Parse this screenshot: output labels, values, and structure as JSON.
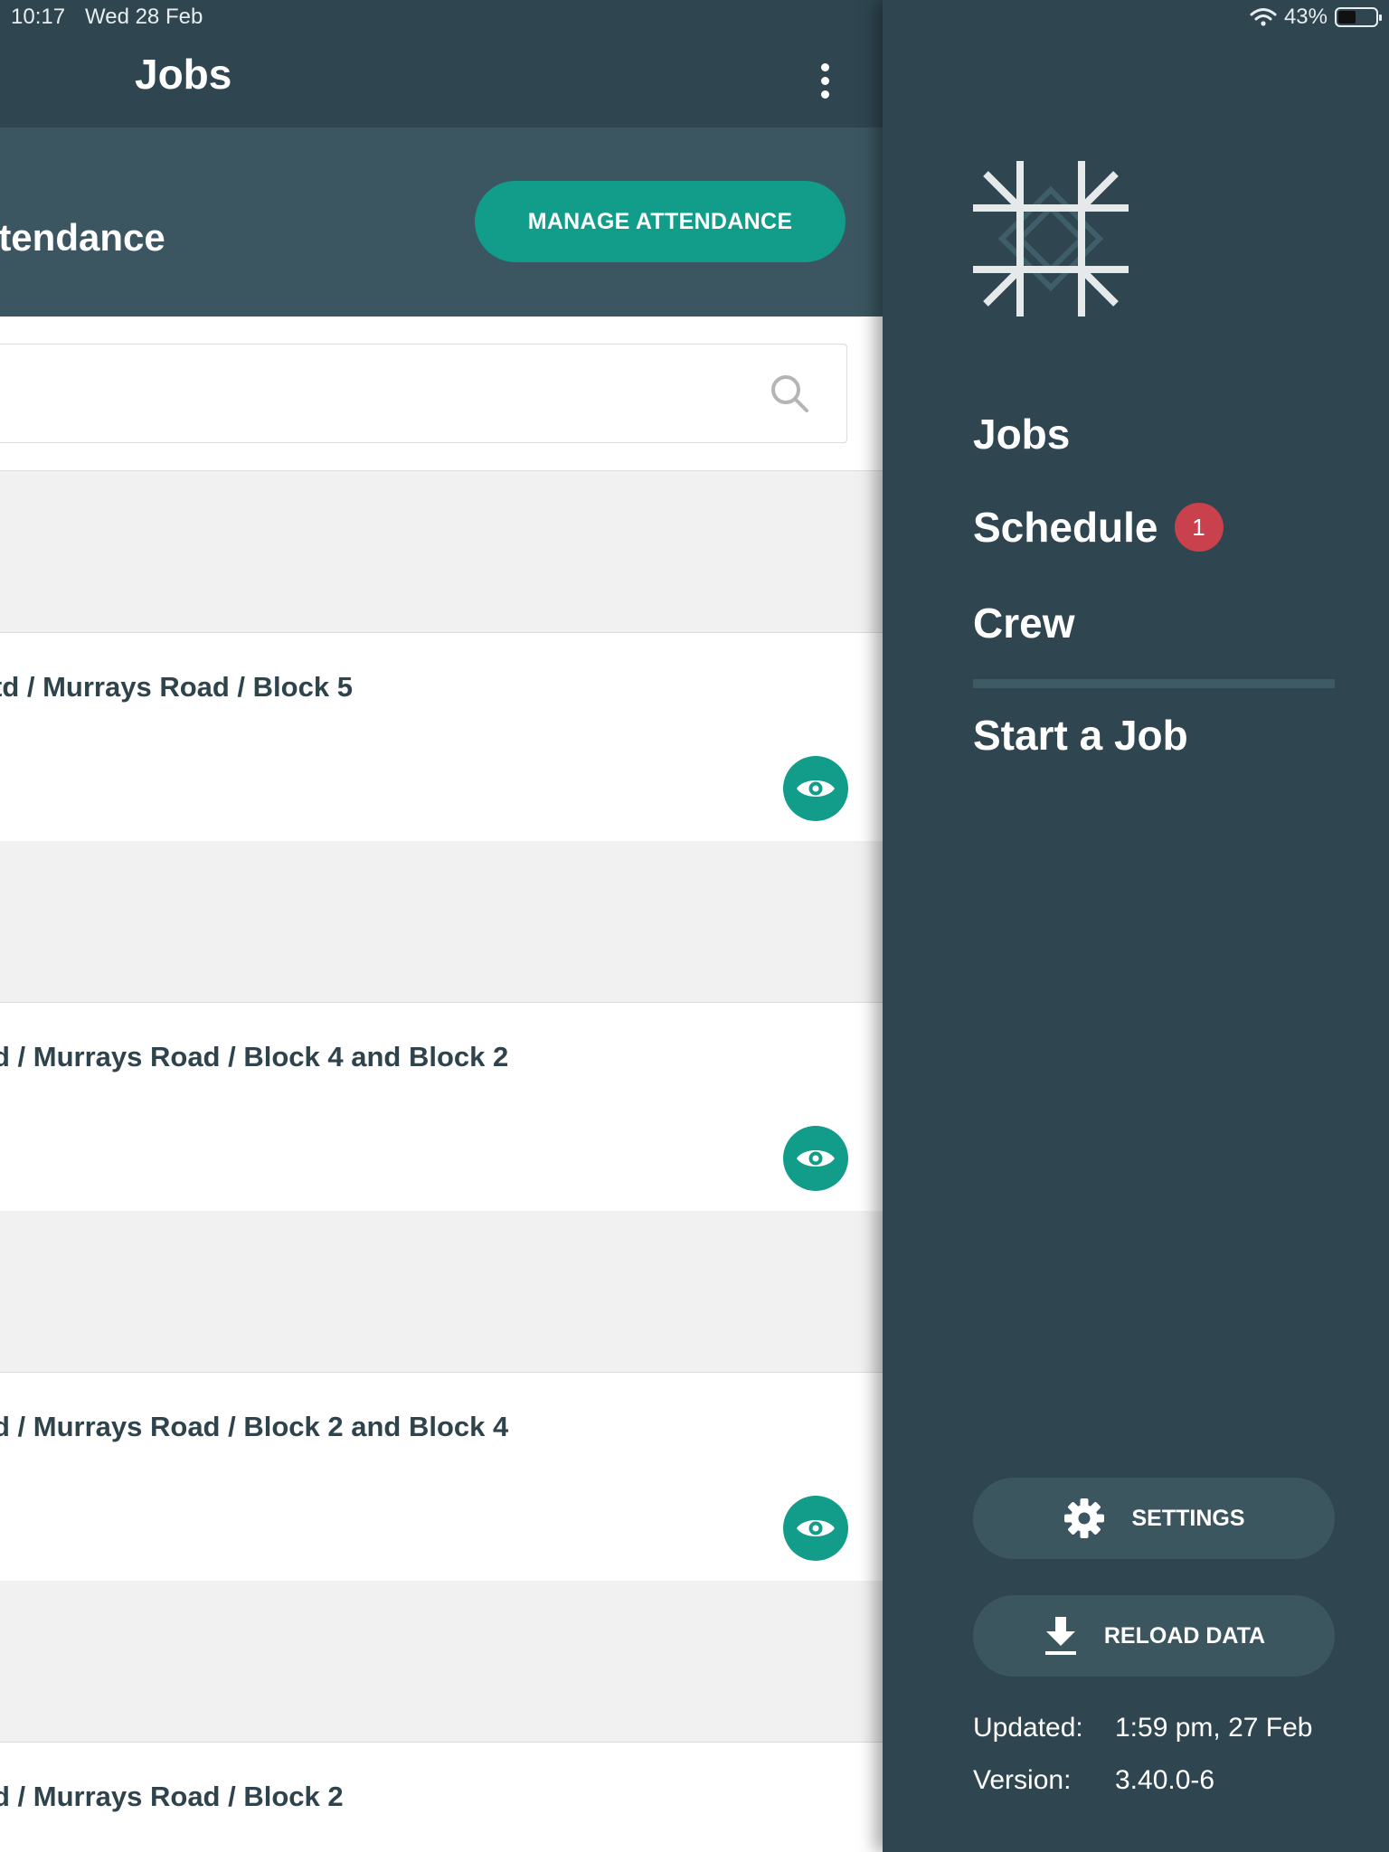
{
  "status_bar": {
    "time": "10:17",
    "date": "Wed 28 Feb",
    "battery": "43%"
  },
  "appbar": {
    "title": "Jobs"
  },
  "attendance": {
    "title": "Attendance",
    "manage_label": "MANAGE ATTENDANCE"
  },
  "search": {
    "placeholder": ""
  },
  "jobs": [
    {
      "title": "td / Murrays Road / Block 5"
    },
    {
      "title": "d / Murrays Road / Block 4 and Block 2"
    },
    {
      "title": "d / Murrays Road / Block 2 and Block 4"
    },
    {
      "title": "d / Murrays Road / Block 2"
    }
  ],
  "drawer": {
    "nav": {
      "jobs": "Jobs",
      "schedule": "Schedule",
      "schedule_badge": "1",
      "crew": "Crew",
      "start_job": "Start a Job"
    },
    "settings_label": "SETTINGS",
    "reload_label": "RELOAD DATA",
    "updated_label": "Updated:",
    "updated_value": "1:59 pm, 27 Feb",
    "version_label": "Version:",
    "version_value": "3.40.0-6"
  },
  "colors": {
    "primary_dark": "#2f4650",
    "accent_teal": "#129c8a",
    "badge_red": "#c8414d",
    "surface": "#ffffff",
    "background": "#f1f1f1"
  }
}
